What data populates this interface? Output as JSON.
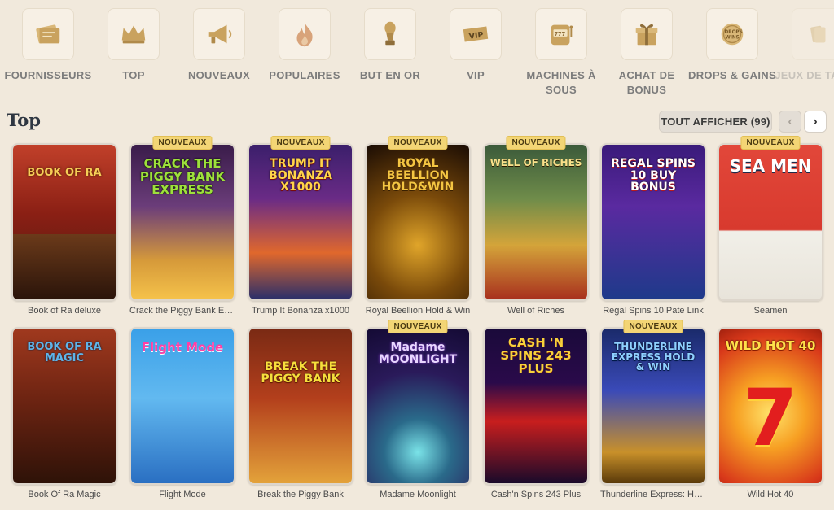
{
  "categories": [
    {
      "label": "FOURNISSEURS",
      "icon": "providers-icon"
    },
    {
      "label": "TOP",
      "icon": "crown-icon"
    },
    {
      "label": "NOUVEAUX",
      "icon": "megaphone-icon"
    },
    {
      "label": "POPULAIRES",
      "icon": "flame-icon"
    },
    {
      "label": "BUT EN OR",
      "icon": "trophy-icon"
    },
    {
      "label": "VIP",
      "icon": "vip-ticket-icon"
    },
    {
      "label": "MACHINES À SOUS",
      "icon": "slot-machine-icon"
    },
    {
      "label": "ACHAT DE BONUS",
      "icon": "gift-icon"
    },
    {
      "label": "DROPS & GAINS",
      "icon": "drops-wins-icon"
    },
    {
      "label": "JEUX DE TABLE",
      "icon": "table-games-icon"
    }
  ],
  "section": {
    "title": "Top",
    "show_all_label": "TOUT AFFICHER (99)",
    "prev_label": "‹",
    "next_label": "›"
  },
  "badge_label": "NOUVEAUX",
  "games": [
    {
      "name": "Book of Ra deluxe",
      "logo": "BOOK OF RA",
      "badge": false
    },
    {
      "name": "Crack the Piggy Bank Express",
      "logo": "CRACK THE PIGGY BANK EXPRESS",
      "badge": true
    },
    {
      "name": "Trump It Bonanza x1000",
      "logo": "TRUMP IT BONANZA x1000",
      "badge": true
    },
    {
      "name": "Royal Beellion Hold & Win",
      "logo": "ROYAL BEELLION HOLD&WIN",
      "badge": true
    },
    {
      "name": "Well of Riches",
      "logo": "WELL OF RICHES",
      "badge": true
    },
    {
      "name": "Regal Spins 10 Pate Link",
      "logo": "REGAL SPINS 10 BUY BONUS",
      "badge": false
    },
    {
      "name": "Seamen",
      "logo": "SEA MEN",
      "badge": true
    },
    {
      "name": "Book Of Ra Magic",
      "logo": "BOOK OF RA MAGIC",
      "badge": false
    },
    {
      "name": "Flight Mode",
      "logo": "Flight Mode",
      "badge": false
    },
    {
      "name": "Break the Piggy Bank",
      "logo": "BREAK THE PIGGY BANK",
      "badge": false
    },
    {
      "name": "Madame Moonlight",
      "logo": "Madame MOONLIGHT",
      "badge": true
    },
    {
      "name": "Cash'n Spins 243 Plus",
      "logo": "CASH 'N SPINS 243 PLUS",
      "badge": false
    },
    {
      "name": "Thunderline Express: Hold & Win",
      "logo": "THUNDERLINE EXPRESS HOLD & WIN",
      "badge": true
    },
    {
      "name": "Wild Hot 40",
      "logo": "WILD HOT 40",
      "badge": false
    }
  ],
  "colors": {
    "background": "#f1e9dc",
    "badge": "#f3d575",
    "icon_gold": "#c9a25e"
  }
}
